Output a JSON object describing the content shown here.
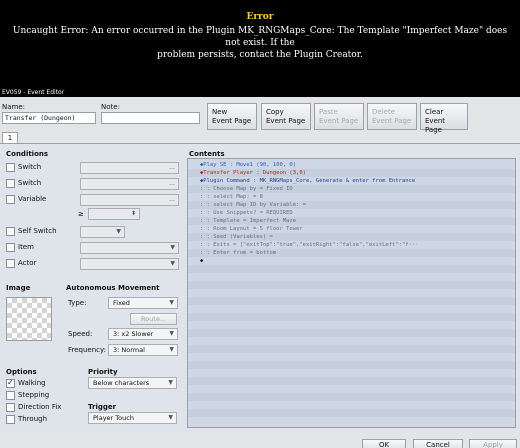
{
  "error": {
    "title": "Error",
    "line1": "Uncaught Error: An error occurred in the Plugin MK_RNGMaps_Core: The Template \"Imperfect Maze\" does not exist. If the",
    "line2": "problem persists, contact the Plugin Creator."
  },
  "window": {
    "title": "EV059 - Event Editor"
  },
  "header": {
    "name_label": "Name:",
    "name_value": "Transfer (Dungeon)",
    "note_label": "Note:",
    "note_value": "",
    "buttons": [
      {
        "label": "New\nEvent Page",
        "enabled": true
      },
      {
        "label": "Copy\nEvent Page",
        "enabled": true
      },
      {
        "label": "Paste\nEvent Page",
        "enabled": false
      },
      {
        "label": "Delete\nEvent Page",
        "enabled": false
      },
      {
        "label": "Clear\nEvent Page",
        "enabled": true
      }
    ]
  },
  "tab": {
    "label": "1"
  },
  "conditions": {
    "title": "Conditions",
    "switch1": "Switch",
    "switch2": "Switch",
    "variable": "Variable",
    "ge": "≥",
    "self_switch": "Self Switch",
    "item": "Item",
    "actor": "Actor"
  },
  "image": {
    "title": "Image"
  },
  "autonomous": {
    "title": "Autonomous Movement",
    "type_label": "Type:",
    "type_value": "Fixed",
    "route_button": "Route...",
    "speed_label": "Speed:",
    "speed_value": "3: x2 Slower",
    "frequency_label": "Frequency:",
    "frequency_value": "3: Normal"
  },
  "options": {
    "title": "Options",
    "walking": "Walking",
    "stepping": "Stepping",
    "direction_fix": "Direction Fix",
    "through": "Through",
    "walking_checked": true
  },
  "priority": {
    "title": "Priority",
    "value": "Below characters"
  },
  "trigger": {
    "title": "Trigger",
    "value": "Player Touch"
  },
  "contents": {
    "title": "Contents",
    "rows": [
      {
        "text": "◆Play SE : Move1 (90, 100, 0)",
        "color": "#2a5cc4"
      },
      {
        "text": "◆Transfer Player : Dungeon (3,0)",
        "color": "#b22222"
      },
      {
        "text": "◆Plugin Command : MK_RNGMaps_Core, Generate & enter from Entrance",
        "color": "#1f3f8f"
      },
      {
        "text": "      :                : Choose Map by = Fixed ID",
        "color": "#666f7a"
      },
      {
        "text": "      :                : select Map: = 8",
        "color": "#666f7a"
      },
      {
        "text": "      :                : select Map ID by Variable: =",
        "color": "#666f7a"
      },
      {
        "text": "      :                : Use Snippets? = REQUIRED",
        "color": "#666f7a"
      },
      {
        "text": "      :                : Template = Imperfect Maze",
        "color": "#666f7a"
      },
      {
        "text": "      :                : Room Layout = 5 floor Tower",
        "color": "#666f7a"
      },
      {
        "text": "      :                : Seed (Variables) =",
        "color": "#666f7a"
      },
      {
        "text": "      :                : Exits = [\"exitTop\":\"true\",\"exitRight\":\"false\",\"exitLeft\":\"f···",
        "color": "#666f7a"
      },
      {
        "text": "      :                : Enter from = bottom",
        "color": "#666f7a"
      },
      {
        "text": "◆",
        "color": "#111111"
      }
    ]
  },
  "footer": {
    "ok": "OK",
    "cancel": "Cancel",
    "apply": "Apply"
  }
}
